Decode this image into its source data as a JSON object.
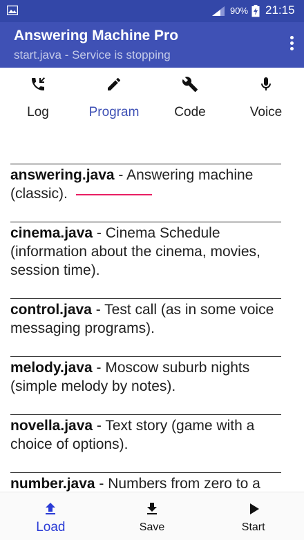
{
  "status_bar": {
    "battery_percent": "90%",
    "time": "21:15",
    "left_icon": "image-icon",
    "signal_icon": "signal-icon",
    "battery_icon": "battery-charging-icon"
  },
  "app_bar": {
    "title": "Answering Machine Pro",
    "subtitle": "start.java - Service is stopping",
    "menu_icon": "more-vert-icon"
  },
  "tabs": [
    {
      "label": "Log",
      "icon": "call-log-icon",
      "active": false
    },
    {
      "label": "Program",
      "icon": "edit-icon",
      "active": true
    },
    {
      "label": "Code",
      "icon": "wrench-icon",
      "active": false
    },
    {
      "label": "Voice",
      "icon": "mic-icon",
      "active": false
    }
  ],
  "programs": [
    {
      "name": "answering.java",
      "description": " - Answering machine (classic)."
    },
    {
      "name": "cinema.java",
      "description": " - Cinema Schedule (information about the cinema, movies, session time)."
    },
    {
      "name": "control.java",
      "description": " - Test call (as in some voice messaging programs)."
    },
    {
      "name": "melody.java",
      "description": " - Moscow suburb nights (simple melody by notes)."
    },
    {
      "name": "novella.java",
      "description": " - Text story (game with a choice of options)."
    },
    {
      "name": "number.java",
      "description": " - Numbers from zero to a"
    }
  ],
  "bottom_nav": [
    {
      "label": "Load",
      "icon": "upload-icon",
      "active": true
    },
    {
      "label": "Save",
      "icon": "download-icon",
      "active": false
    },
    {
      "label": "Start",
      "icon": "play-icon",
      "active": false
    }
  ],
  "colors": {
    "primary": "#3f51b5",
    "primary_dark": "#3347a8",
    "accent": "#e91e63",
    "active_nav": "#2a3bd6"
  }
}
